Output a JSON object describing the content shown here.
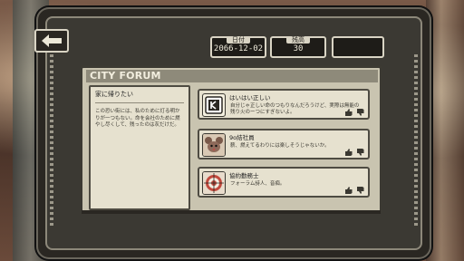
{
  "header": {
    "date_label": "日付",
    "date_value": "2066-12-02",
    "count_label": "残高",
    "count_value": "30",
    "extra_value": ""
  },
  "forum": {
    "title": "CITY FORUM",
    "thread": {
      "title": "家に帰りたい",
      "body": "この恐い街には、私のために灯る明かりが一つもない。命を会社のために燃やし尽くして、残ったのは灰だけだ。"
    },
    "posts": [
      {
        "name": "はいはい正しい",
        "text": "自分じゃ正しい命のつもりなんだろうけど、実際は無能の残り火のーつにすぎないよ。",
        "avatar_icon": "rat-emblem-icon"
      },
      {
        "name": "9o結社員",
        "text": "薪、燃えてるわりには楽しそうじゃないか。",
        "avatar_icon": "rat-face-icon"
      },
      {
        "name": "協約勤務士",
        "text": "フォーラム詩人、音痴。",
        "avatar_icon": "target-face-icon"
      }
    ]
  },
  "icons": {
    "back": "back-arrow-icon",
    "upvote": "thumbs-up-icon",
    "downvote": "thumbs-down-icon"
  },
  "colors": {
    "frame": "#2a2722",
    "panel": "#c9c4b0",
    "card": "#e6e1cf",
    "title_bar": "#8e8a7a",
    "text_light": "#ece8d8"
  }
}
